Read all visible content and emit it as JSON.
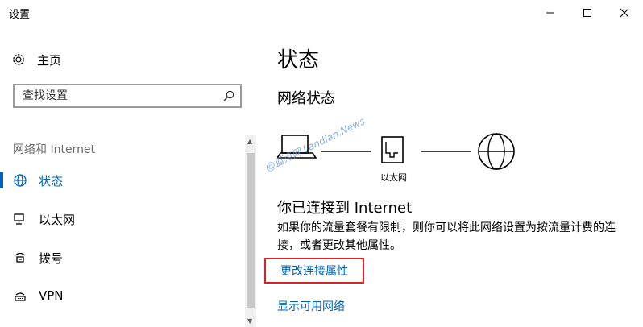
{
  "window": {
    "title": "设置"
  },
  "sidebar": {
    "home_label": "主页",
    "search_placeholder": "查找设置",
    "section_label": "网络和 Internet",
    "items": [
      {
        "label": "状态",
        "icon": "globe-icon",
        "active": true
      },
      {
        "label": "以太网",
        "icon": "ethernet-icon",
        "active": false
      },
      {
        "label": "拨号",
        "icon": "dialup-icon",
        "active": false
      },
      {
        "label": "VPN",
        "icon": "vpn-icon",
        "active": false
      }
    ]
  },
  "main": {
    "title": "状态",
    "subtitle": "网络状态",
    "adapter_label": "以太网",
    "connection_title": "你已连接到 Internet",
    "description": "如果你的流量套餐有限制，则你可以将此网络设置为按流量计费的连接，或者更改其他属性。",
    "change_link": "更改连接属性",
    "show_networks_link": "显示可用网络"
  },
  "watermark": "@蓝点网 Landian.News",
  "colors": {
    "accent": "#0063b1",
    "highlight_border": "#e01f25"
  }
}
